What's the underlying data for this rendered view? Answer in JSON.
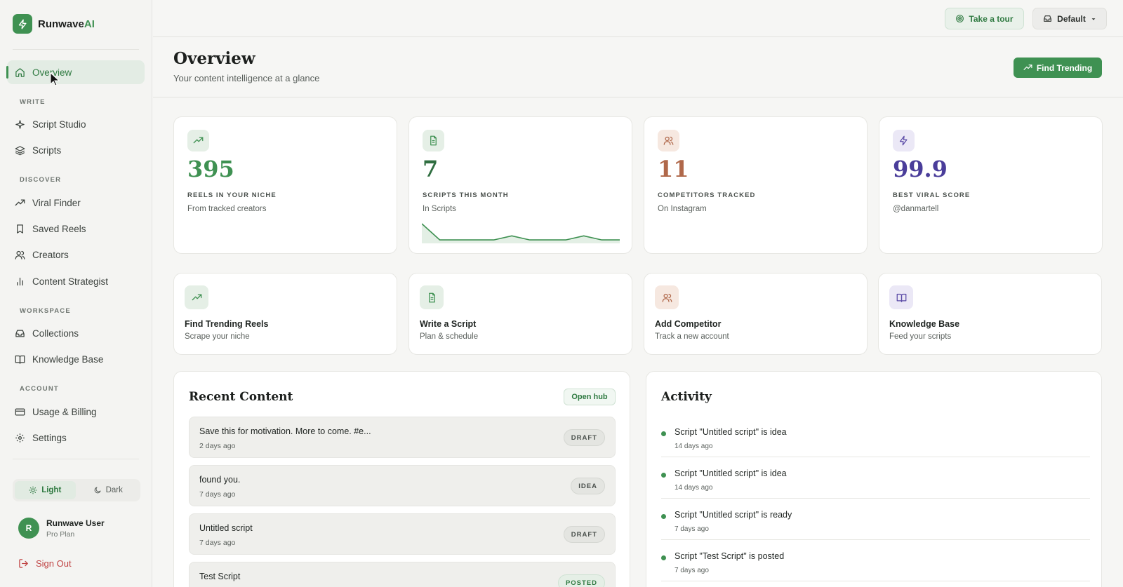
{
  "brand": {
    "name_main": "Runwave",
    "name_accent": "AI"
  },
  "nav": {
    "overview": "Overview",
    "sections": {
      "write": "WRITE",
      "discover": "DISCOVER",
      "workspace": "WORKSPACE",
      "account": "ACCOUNT"
    },
    "script_studio": "Script Studio",
    "scripts": "Scripts",
    "viral_finder": "Viral Finder",
    "saved_reels": "Saved Reels",
    "creators": "Creators",
    "content_strategist": "Content Strategist",
    "collections": "Collections",
    "knowledge_base": "Knowledge Base",
    "usage_billing": "Usage & Billing",
    "settings": "Settings"
  },
  "theme": {
    "light": "Light",
    "dark": "Dark"
  },
  "user": {
    "initial": "R",
    "name": "Runwave User",
    "plan": "Pro Plan"
  },
  "sign_out": "Sign Out",
  "topbar": {
    "tour": "Take a tour",
    "workspace": "Default"
  },
  "header": {
    "title": "Overview",
    "subtitle": "Your content intelligence at a glance",
    "find_trending": "Find Trending"
  },
  "stats": [
    {
      "value": "395",
      "label": "REELS IN YOUR NICHE",
      "sub": "From tracked creators",
      "color": "#3f9152"
    },
    {
      "value": "7",
      "label": "SCRIPTS THIS MONTH",
      "sub": "In Scripts",
      "color": "#2f6e40"
    },
    {
      "value": "11",
      "label": "COMPETITORS TRACKED",
      "sub": "On Instagram",
      "color": "#b0684a"
    },
    {
      "value": "99.9",
      "label": "BEST VIRAL SCORE",
      "sub": "@danmartell",
      "color": "#4a3d9a"
    }
  ],
  "sparkline": [
    9,
    1,
    1,
    1,
    1,
    3,
    1,
    1,
    1,
    3,
    1,
    1
  ],
  "actions": [
    {
      "title": "Find Trending Reels",
      "sub": "Scrape your niche"
    },
    {
      "title": "Write a Script",
      "sub": "Plan & schedule"
    },
    {
      "title": "Add Competitor",
      "sub": "Track a new account"
    },
    {
      "title": "Knowledge Base",
      "sub": "Feed your scripts"
    }
  ],
  "recent": {
    "title": "Recent Content",
    "open_hub": "Open hub",
    "items": [
      {
        "title": "Save this for motivation. More to come. #e...",
        "time": "2 days ago",
        "status": "DRAFT"
      },
      {
        "title": "found you.",
        "time": "7 days ago",
        "status": "IDEA"
      },
      {
        "title": "Untitled script",
        "time": "7 days ago",
        "status": "DRAFT"
      },
      {
        "title": "Test Script",
        "time": "",
        "status": "POSTED"
      }
    ]
  },
  "activity": {
    "title": "Activity",
    "items": [
      {
        "text": "Script \"Untitled script\" is idea",
        "time": "14 days ago"
      },
      {
        "text": "Script \"Untitled script\" is idea",
        "time": "14 days ago"
      },
      {
        "text": "Script \"Untitled script\" is ready",
        "time": "7 days ago"
      },
      {
        "text": "Script \"Test Script\" is posted",
        "time": "7 days ago"
      }
    ]
  }
}
